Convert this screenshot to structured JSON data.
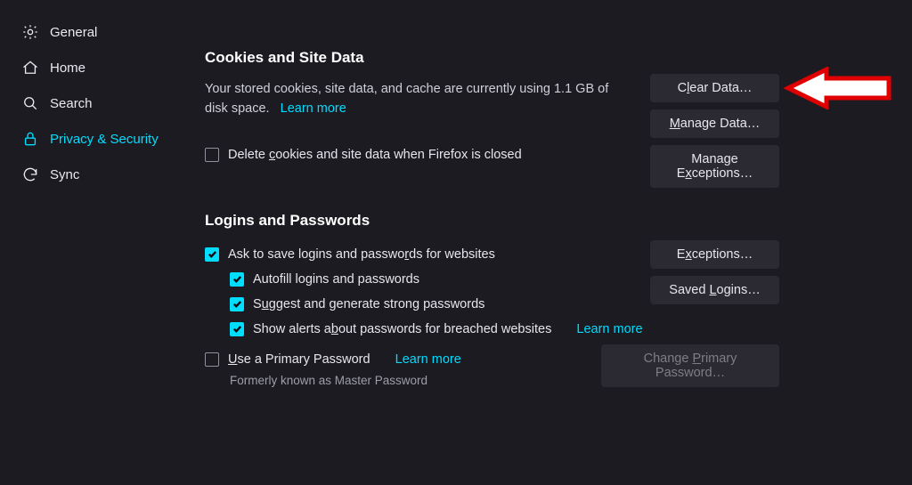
{
  "sidebar": {
    "items": [
      {
        "label": "General"
      },
      {
        "label": "Home"
      },
      {
        "label": "Search"
      },
      {
        "label": "Privacy & Security"
      },
      {
        "label": "Sync"
      }
    ]
  },
  "cookies": {
    "title": "Cookies and Site Data",
    "desc1": "Your stored cookies, site data, and cache are currently using 1.1 GB of disk space.",
    "learn_more": "Learn more",
    "clear_btn_pre": "C",
    "clear_btn_key": "l",
    "clear_btn_post": "ear Data…",
    "manage_btn_pre": "",
    "manage_btn_key": "M",
    "manage_btn_post": "anage Data…",
    "exc_btn_pre": "Manage E",
    "exc_btn_key": "x",
    "exc_btn_post": "ceptions…",
    "delete_label_pre": "Delete ",
    "delete_label_key": "c",
    "delete_label_post": "ookies and site data when Firefox is closed"
  },
  "logins": {
    "title": "Logins and Passwords",
    "ask_pre": "Ask to save logins and passwo",
    "ask_key": "r",
    "ask_post": "ds for websites",
    "autofill": "Autofill logins and passwords",
    "suggest_pre": "S",
    "suggest_key": "u",
    "suggest_post": "ggest and generate strong passwords",
    "alerts_pre": "Show alerts a",
    "alerts_key": "b",
    "alerts_post": "out passwords for breached websites",
    "learn_more": "Learn more",
    "primary_pre": "",
    "primary_key": "U",
    "primary_post": "se a Primary Password",
    "formerly": "Formerly known as Master Password",
    "exc_btn_pre": "E",
    "exc_btn_key": "x",
    "exc_btn_post": "ceptions…",
    "saved_btn_pre": "Saved ",
    "saved_btn_key": "L",
    "saved_btn_post": "ogins…",
    "change_btn_pre": "Change ",
    "change_btn_key": "P",
    "change_btn_post": "rimary Password…"
  },
  "colors": {
    "accent": "#00ddff",
    "annot": "#e00000"
  }
}
